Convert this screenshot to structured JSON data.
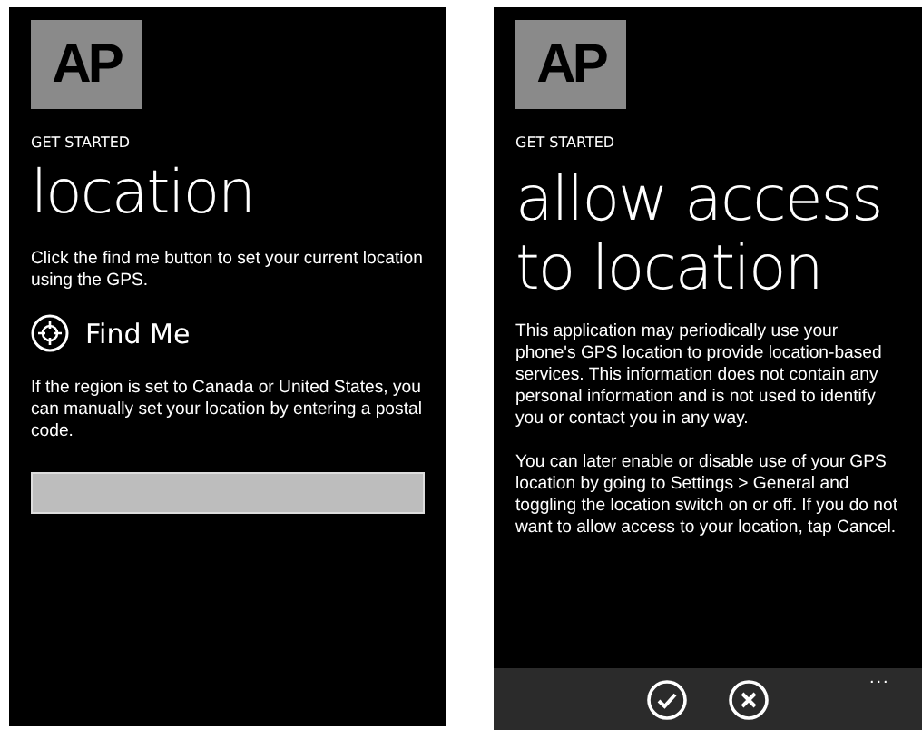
{
  "screens": [
    {
      "logo": "AP",
      "eyebrow": "GET STARTED",
      "title": "location",
      "body": [
        "Click the find me button to set your current location using the GPS."
      ],
      "find_me": {
        "label": "Find Me"
      },
      "note": "If the region is set to Canada or United States, you can manually set your location by entering a postal code.",
      "postal_field": true
    },
    {
      "logo": "AP",
      "eyebrow": "GET STARTED",
      "title": "allow access to location",
      "body": [
        "This application may periodically use your phone's GPS location to provide location-based services. This information does not contain any personal information and is not used to identify you or contact you in any way.",
        "You can later enable or disable use of your GPS location by going to Settings > General and toggling the location switch on or off. If you do not want to allow access to your location, tap Cancel."
      ],
      "app_bar": {
        "buttons": [
          {
            "kind": "accept"
          },
          {
            "kind": "cancel"
          }
        ],
        "more": "..."
      }
    }
  ]
}
